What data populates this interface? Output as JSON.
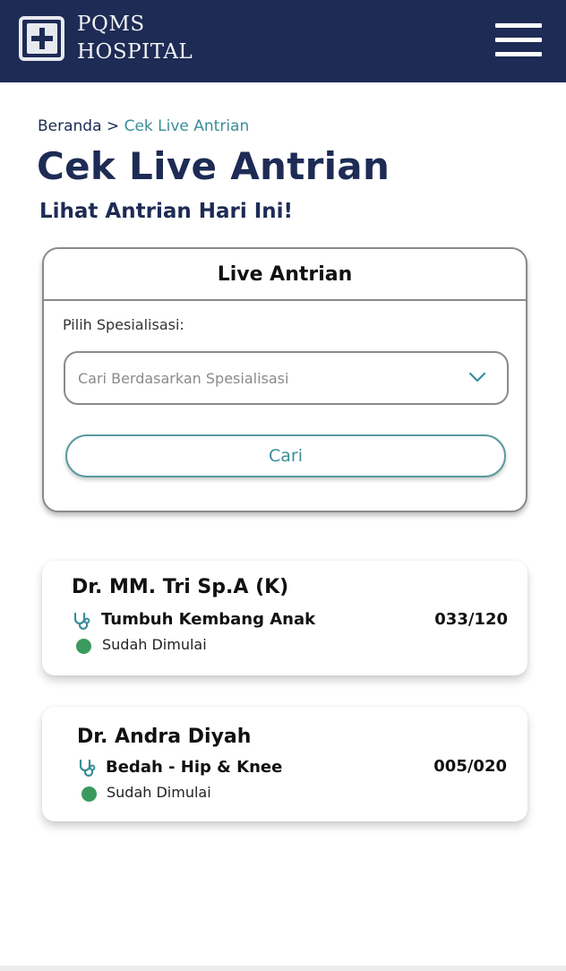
{
  "header": {
    "brand_line1": "PQMS",
    "brand_line2": "HOSPITAL",
    "logo_icon": "plus-cross-icon",
    "menu_icon": "hamburger-menu-icon",
    "background_color": "#1d2b55"
  },
  "breadcrumb": {
    "home": "Beranda",
    "separator": ">",
    "current": "Cek Live Antrian"
  },
  "page": {
    "title": "Cek Live Antrian",
    "subtitle": "Lihat Antrian Hari Ini!"
  },
  "queue_card": {
    "title": "Live Antrian",
    "specialization_label": "Pilih Spesialisasi:",
    "select_placeholder": "Cari Berdasarkan Spesialisasi",
    "select_icon": "chevron-down-icon",
    "search_button": "Cari",
    "accent_color": "#3a8e98"
  },
  "doctors": [
    {
      "name": "Dr. MM. Tri Sp.A (K)",
      "specialization": "Tumbuh Kembang Anak",
      "status": "Sudah Dimulai",
      "queue": "033/120",
      "icon": "stethoscope-icon",
      "status_color": "#3b9a5f"
    },
    {
      "name": "Dr. Andra Diyah",
      "specialization": "Bedah - Hip & Knee",
      "status": "Sudah Dimulai",
      "queue": "005/020",
      "icon": "stethoscope-icon",
      "status_color": "#3b9a5f"
    }
  ]
}
